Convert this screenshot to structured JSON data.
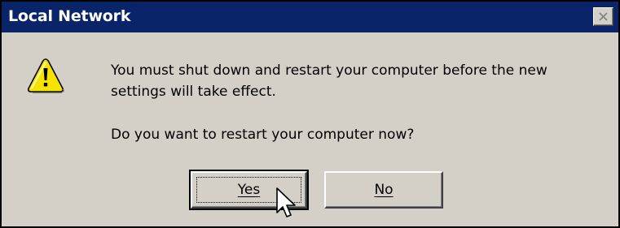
{
  "window": {
    "title": "Local Network"
  },
  "icons": {
    "warning": "warning-icon",
    "close": "close-icon",
    "cursor": "mouse-pointer"
  },
  "message": {
    "line1": "You must shut down and restart your computer before the new",
    "line2": "settings will take effect.",
    "question": "Do you want to restart your computer now?"
  },
  "buttons": {
    "yes_label": "Yes",
    "no_label": "No",
    "default": "Yes"
  },
  "colors": {
    "titlebar": "#0a246a",
    "dialog_bg": "#d4d0c8",
    "warning_fill": "#f7e300"
  }
}
